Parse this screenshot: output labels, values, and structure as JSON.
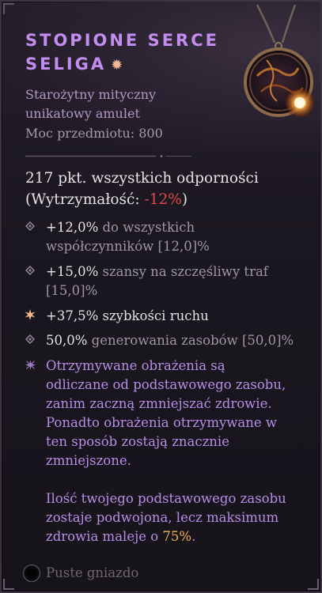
{
  "item": {
    "name_line1": "STOPIONE SERCE",
    "name_line2": "SELIGA",
    "name_star": "✹",
    "type_line1": "Starożytny mityczny",
    "type_line2": "unikatowy amulet",
    "item_power": "Moc przedmiotu: 800"
  },
  "stats": {
    "resist_line1": "217 pkt. wszystkich odporności",
    "resist_line2_pre": "(Wytrzymałość: ",
    "resist_line2_neg": "-12%",
    "resist_line2_post": ")"
  },
  "affixes": [
    {
      "line1_val": "+12,0%",
      "line1_rest": " do wszystkich",
      "line2": "współczynników [12,0]%"
    },
    {
      "line1_val": "+15,0%",
      "line1_rest": " szansy na szczęśliwy traf",
      "line2": "[15,0]%"
    },
    {
      "line1_val": "+37,5% szybkości ruchu",
      "line1_rest": ""
    },
    {
      "line1_val": "50,0%",
      "line1_rest": " generowania zasobów [50,0]%"
    }
  ],
  "legendary": {
    "lines": [
      "Otrzymywane obrażenia są",
      "odliczane od podstawowego zasobu,",
      "zanim zaczną zmniejszać zdrowie.",
      "Ponadto obrażenia otrzymywane w",
      "ten sposób zostają znacznie",
      "zmniejszone.",
      "",
      "Ilość twojego podstawowego zasobu",
      "zostaje podwojona, lecz maksimum"
    ],
    "last_pre": "zdrowia maleje o ",
    "last_hi": "75%",
    "last_post": "."
  },
  "socket": {
    "label": "Puste gniazdo"
  },
  "colors": {
    "title": "#c38df0",
    "legendary": "#b78ee6",
    "negative": "#e04848",
    "highlight": "#f1b04e"
  }
}
